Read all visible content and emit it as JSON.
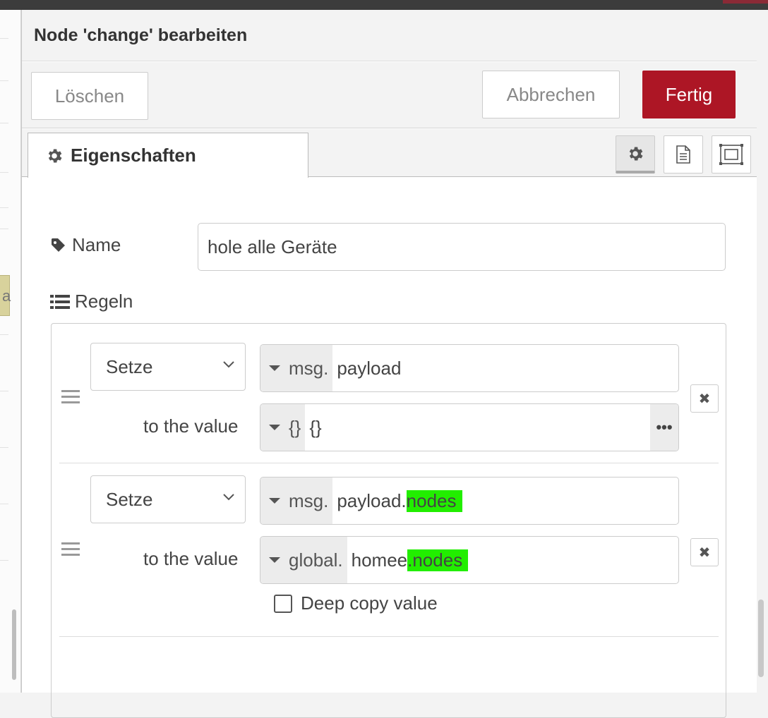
{
  "dialog": {
    "title": "Node 'change' bearbeiten"
  },
  "toolbar": {
    "delete_label": "Löschen",
    "cancel_label": "Abbrechen",
    "done_label": "Fertig"
  },
  "tabs": {
    "properties_label": "Eigenschaften",
    "icons": [
      "gear-icon",
      "document-icon",
      "layout-icon"
    ]
  },
  "form": {
    "name_label": "Name",
    "name_value": "hole alle Geräte",
    "rules_label": "Regeln"
  },
  "rules": [
    {
      "action": "Setze",
      "target_type": "msg.",
      "target_value": "payload",
      "target_highlight": "",
      "to_label": "to the value",
      "value_type": "{}",
      "value": "{}",
      "value_highlight": ""
    },
    {
      "action": "Setze",
      "target_type": "msg.",
      "target_value": "payload.",
      "target_highlight": "nodes",
      "to_label": "to the value",
      "value_type": "global.",
      "value": "homee",
      "value_highlight": ".nodes",
      "deep_copy_label": "Deep copy value",
      "deep_copy_checked": false
    }
  ],
  "workspace": {
    "node_letter": "a"
  },
  "colors": {
    "primary": "#ad1625",
    "highlight": "#22ee00"
  }
}
